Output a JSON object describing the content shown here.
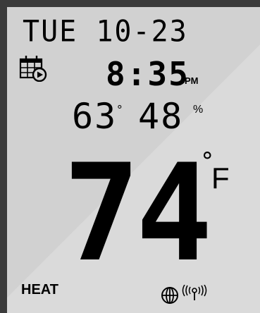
{
  "display": {
    "date": "TUE 10-23",
    "time": "8:35",
    "ampm": "PM",
    "outdoor_temp": "63",
    "outdoor_temp_unit_symbol": "°",
    "humidity": "48",
    "humidity_unit": "%",
    "set_temperature": "74",
    "temp_degree_symbol": "°",
    "temp_unit": "F",
    "mode": "HEAT"
  },
  "icons": {
    "schedule": "calendar-play-icon",
    "network": "globe-icon",
    "wireless": "wireless-signal-icon"
  },
  "colors": {
    "lcd_background": "#d1d1d1",
    "segment": "#000000",
    "bezel": "#3b3b3b"
  }
}
